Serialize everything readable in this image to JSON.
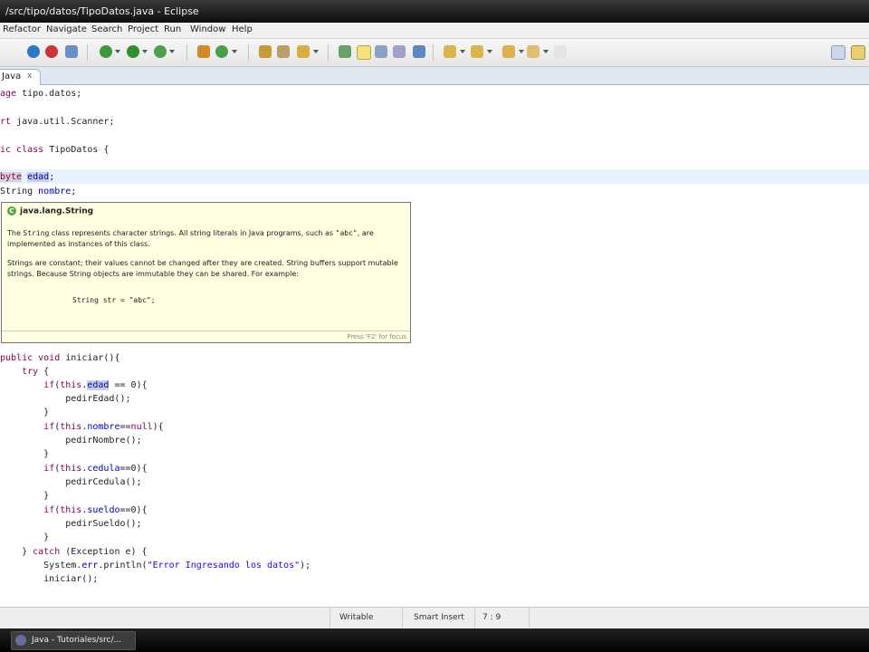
{
  "window": {
    "title": "/src/tipo/datos/TipoDatos.java - Eclipse"
  },
  "menu": [
    "Refactor",
    "Navigate",
    "Search",
    "Project",
    "Run",
    "Window",
    "Help"
  ],
  "editor_tab": {
    "label": "Java",
    "close": "x"
  },
  "code_lines": [
    {
      "text": "age tipo.datos;"
    },
    {
      "text": "rt java.util.Scanner;"
    },
    {
      "text": "ic class TipoDatos {"
    },
    {
      "text": "byte edad;"
    },
    {
      "text": "String nombre;"
    },
    {
      "text": "public void iniciar(){"
    },
    {
      "text": "    try {"
    },
    {
      "text": "        if(this.edad == 0){"
    },
    {
      "text": "            pedirEdad();"
    },
    {
      "text": "        }"
    },
    {
      "text": "        if(this.nombre==null){"
    },
    {
      "text": "            pedirNombre();"
    },
    {
      "text": "        }"
    },
    {
      "text": "        if(this.cedula==0){"
    },
    {
      "text": "            pedirCedula();"
    },
    {
      "text": "        }"
    },
    {
      "text": "        if(this.sueldo==0){"
    },
    {
      "text": "            pedirSueldo();"
    },
    {
      "text": "        }"
    },
    {
      "text": "    } catch (Exception e) {"
    },
    {
      "text": "        System.err.println(\"Error Ingresando los datos\");"
    },
    {
      "text": "        iniciar();"
    }
  ],
  "hover": {
    "title": "java.lang.String",
    "p1_a": "The ",
    "p1_code": "String",
    "p1_b": " class represents character strings. All string literals in Java programs, such as ",
    "p1_code2": "\"abc\"",
    "p1_c": ", are implemented as instances of this class.",
    "p2": "Strings are constant; their values cannot be changed after they are created. String buffers support mutable strings. Because String objects are immutable they can be shared. For example:",
    "code": "String str = \"abc\";",
    "footer": "Press 'F2' for focus"
  },
  "status": {
    "writable": "Writable",
    "insert": "Smart Insert",
    "position": "7 : 9"
  },
  "taskbar": {
    "item": "Java - Tutoriales/src/..."
  }
}
